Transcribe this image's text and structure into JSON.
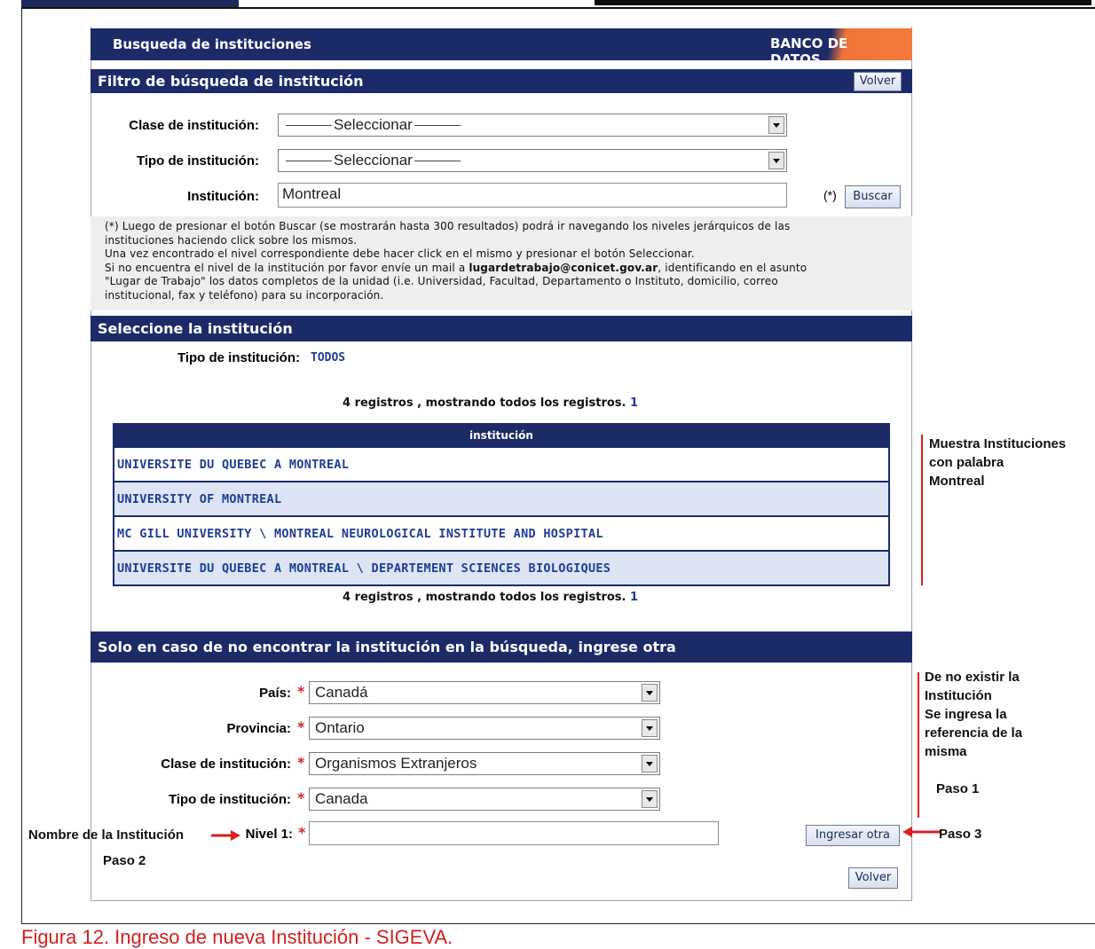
{
  "header": {
    "title": "Busqueda de instituciones",
    "brand": "BANCO DE DATOS"
  },
  "filter": {
    "section_title": "Filtro de búsqueda de institución",
    "volver_label": "Volver",
    "clase_label": "Clase de institución:",
    "clase_value": "Seleccionar",
    "tipo_label": "Tipo de institución:",
    "tipo_value": "Seleccionar",
    "institucion_label": "Institución:",
    "institucion_value": "Montreal",
    "asterisk_note": "(*)",
    "buscar_label": "Buscar"
  },
  "note": {
    "line1": "(*) Luego de presionar el botón Buscar (se mostrarán hasta 300 resultados) podrá ir navegando los niveles jerárquicos de las",
    "line2": "instituciones haciendo click sobre los mismos.",
    "line3": "Una vez encontrado el nivel correspondiente debe hacer click en el mismo y presionar el botón Seleccionar.",
    "line4_pre": "Si no encuentra el nivel de la institución por favor envíe un mail a ",
    "email": "lugardetrabajo@conicet.gov.ar",
    "line4_post": ", identificando en el asunto",
    "line5": "\"Lugar de Trabajo\" los datos completos de la unidad (i.e. Universidad, Facultad, Departamento o Instituto, domicilio, correo",
    "line6": "institucional, fax y teléfono) para su incorporación."
  },
  "select_section": {
    "title": "Seleccione la institución",
    "tipo_label": "Tipo de institución:",
    "tipo_value": "TODOS",
    "records_text": "4 registros , mostrando todos los registros.",
    "page": "1",
    "column_header": "institución",
    "rows": [
      "UNIVERSITE DU QUEBEC A MONTREAL",
      "UNIVERSITY OF MONTREAL",
      "MC GILL UNIVERSITY \\ MONTREAL NEUROLOGICAL INSTITUTE AND HOSPITAL",
      "UNIVERSITE DU QUEBEC A MONTREAL \\ DEPARTEMENT SCIENCES BIOLOGIQUES"
    ]
  },
  "other_section": {
    "title": "Solo en caso de no encontrar la institución en la búsqueda, ingrese otra",
    "pais_label": "País:",
    "pais_value": "Canadá",
    "provincia_label": "Provincia:",
    "provincia_value": "Ontario",
    "clase_label": "Clase de institución:",
    "clase_value": "Organismos Extranjeros",
    "tipo_label": "Tipo de institución:",
    "tipo_value": "Canada",
    "nivel_label": "Nivel 1:",
    "nivel_value": "",
    "required_mark": "*",
    "ingresar_label": "Ingresar otra",
    "volver_label": "Volver"
  },
  "annotations": {
    "muestra": [
      "Muestra Instituciones",
      "con palabra",
      "Montreal"
    ],
    "no_existir": [
      "De no existir la",
      "Institución",
      "Se ingresa la",
      "referencia de la",
      "misma"
    ],
    "paso1": "Paso 1",
    "paso2": "Paso 2",
    "paso3": "Paso 3",
    "nombre": "Nombre de la Institución"
  },
  "caption": "Figura 12. Ingreso de nueva Institución - SIGEVA.",
  "colors": {
    "navy": "#1c2b68",
    "orange": "#f27a3c",
    "link": "#1f3d95",
    "annotation_red": "#d92020"
  }
}
